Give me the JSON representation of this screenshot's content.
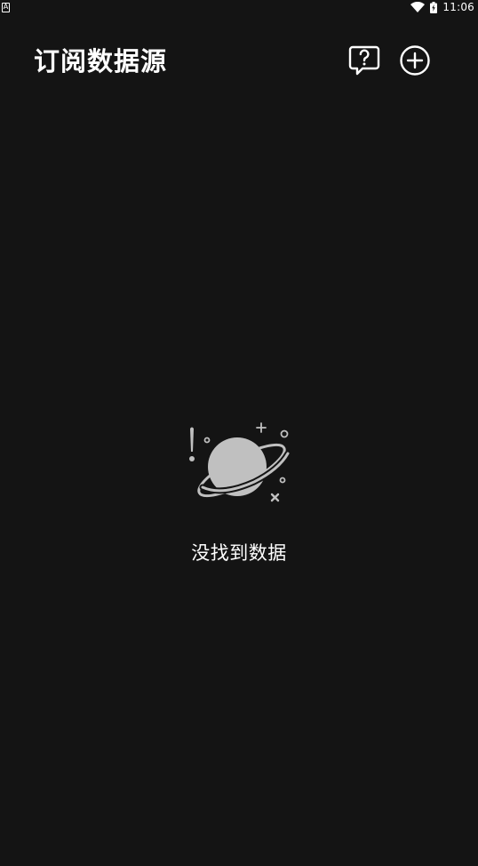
{
  "status_bar": {
    "notification_glyph": "A",
    "time": "11:06",
    "icons": [
      "wifi-icon",
      "battery-charging-icon"
    ]
  },
  "header": {
    "title": "订阅数据源",
    "actions": [
      "help-icon",
      "add-circle-icon"
    ]
  },
  "empty_state": {
    "illustration": "planet-icon",
    "message": "没找到数据"
  },
  "colors": {
    "background": "#141414",
    "text": "#ffffff",
    "illustration": "#c0c0c0"
  }
}
